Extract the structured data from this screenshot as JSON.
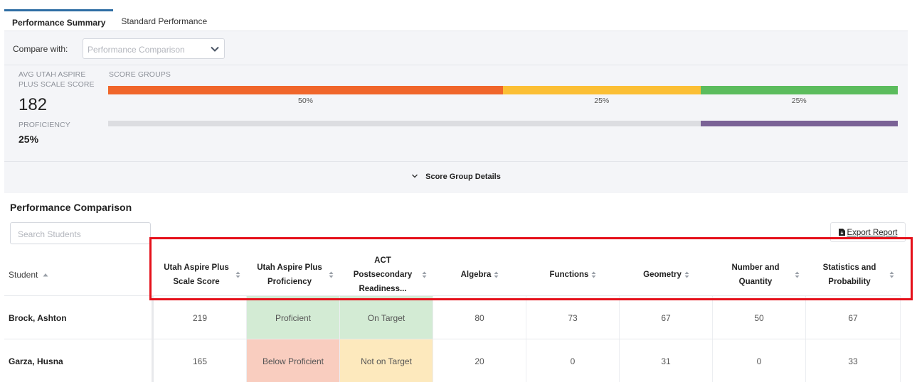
{
  "tabs": [
    {
      "label": "Performance Summary",
      "active": true
    },
    {
      "label": "Standard Performance",
      "active": false
    }
  ],
  "compare": {
    "label": "Compare with:",
    "placeholder": "Performance Comparison"
  },
  "summary": {
    "avg_label": "AVG UTAH ASPIRE PLUS SCALE SCORE",
    "avg_value": "182",
    "proficiency_label": "PROFICIENCY",
    "proficiency_value": "25%",
    "score_groups_label": "SCORE GROUPS",
    "score_groups": [
      {
        "percent": 50,
        "label": "50%",
        "color": "#f0662b"
      },
      {
        "percent": 25,
        "label": "25%",
        "color": "#fbbf35"
      },
      {
        "percent": 25,
        "label": "25%",
        "color": "#5bbc5d"
      }
    ],
    "proficiency_bar": {
      "filled_percent": 25,
      "fill_color": "#7a6296",
      "track_color": "#dcdde1"
    },
    "details_label": "Score Group Details"
  },
  "comparison": {
    "title": "Performance Comparison",
    "search_placeholder": "Search Students",
    "export_label": "Export Report",
    "columns": [
      "Student",
      "Utah Aspire Plus Scale Score",
      "Utah Aspire Plus Proficiency",
      "ACT Postsecondary Readiness...",
      "Algebra",
      "Functions",
      "Geometry",
      "Number and Quantity",
      "Statistics and Probability"
    ],
    "rows": [
      {
        "student": "Brock, Ashton",
        "scale_score": "219",
        "proficiency": "Proficient",
        "act": "On Target",
        "algebra": "80",
        "functions": "73",
        "geometry": "67",
        "number_quantity": "50",
        "statistics": "67",
        "proficiency_color": "#d3ebd4",
        "act_color": "#d3ebd4"
      },
      {
        "student": "Garza, Husna",
        "scale_score": "165",
        "proficiency": "Below Proficient",
        "act": "Not on Target",
        "algebra": "20",
        "functions": "0",
        "geometry": "31",
        "number_quantity": "0",
        "statistics": "33",
        "proficiency_color": "#f9cdbf",
        "act_color": "#fde9bd"
      }
    ]
  },
  "colors": {
    "tab_accent": "#2e6da4",
    "highlight_box": "#e5101a"
  }
}
